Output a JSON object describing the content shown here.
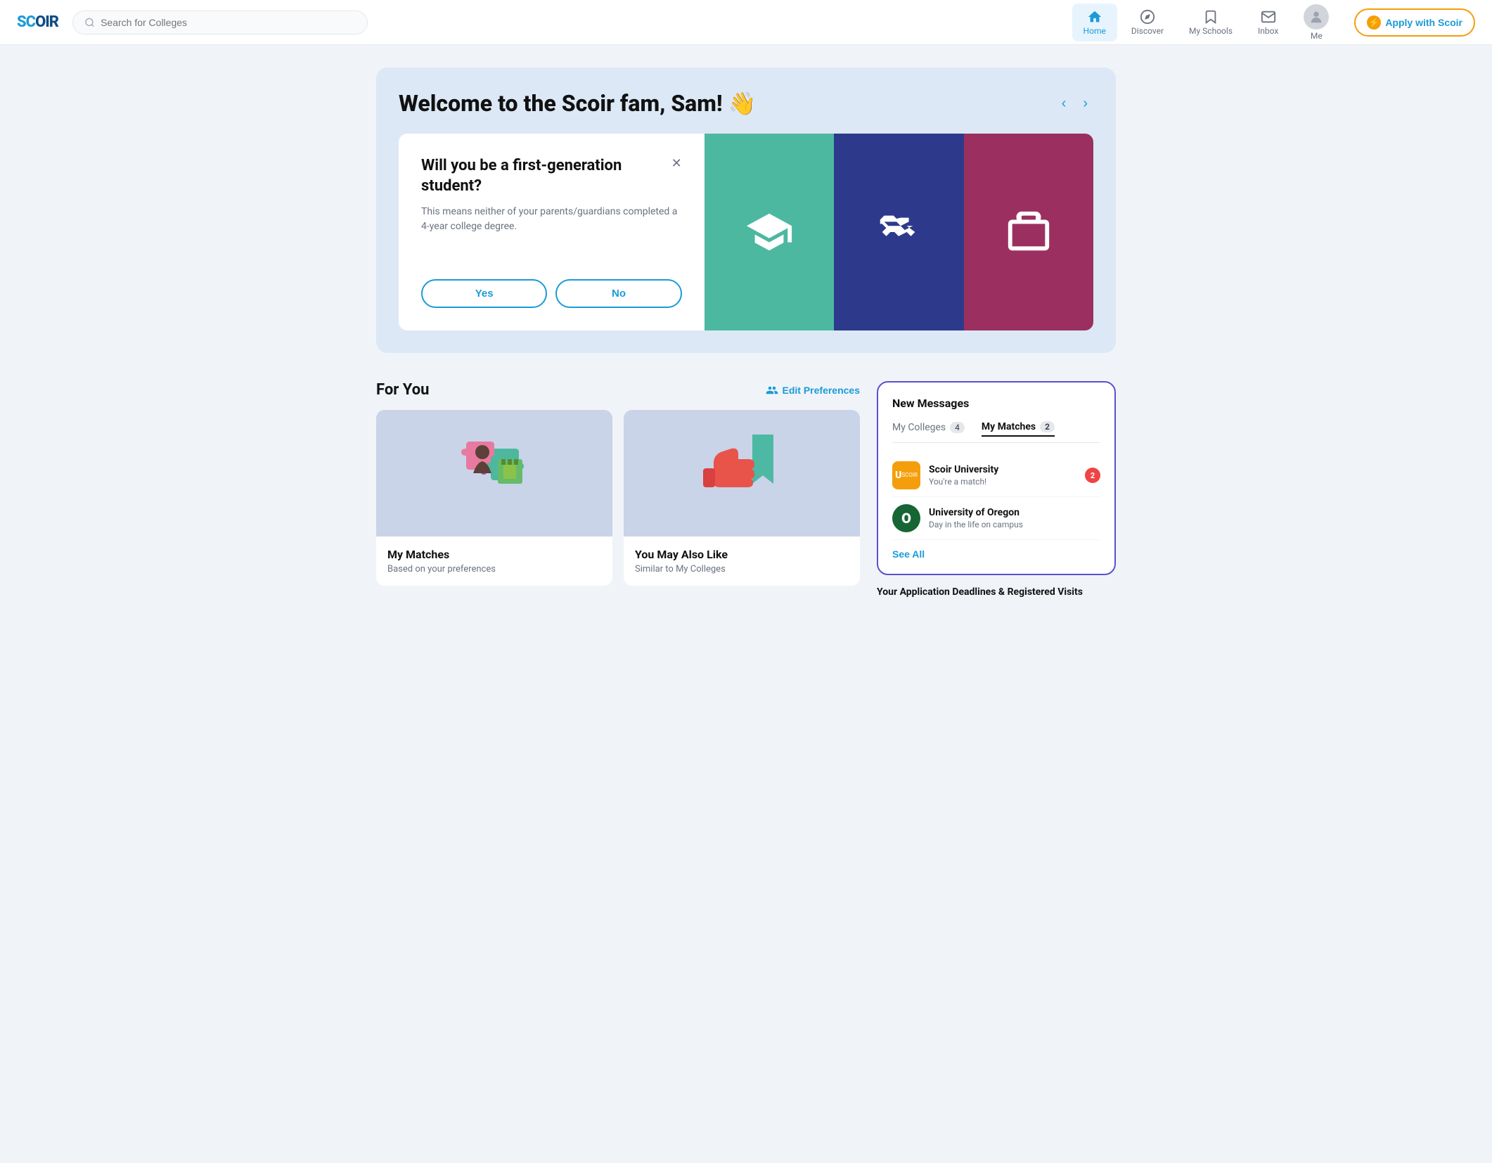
{
  "brand": {
    "logo_s": "SC",
    "logo_full": "SCOIR"
  },
  "navbar": {
    "search_placeholder": "Search for Colleges",
    "nav_items": [
      {
        "id": "home",
        "label": "Home",
        "active": true
      },
      {
        "id": "discover",
        "label": "Discover",
        "active": false
      },
      {
        "id": "my-schools",
        "label": "My Schools",
        "active": false
      },
      {
        "id": "inbox",
        "label": "Inbox",
        "active": false
      },
      {
        "id": "me",
        "label": "Me",
        "active": false
      }
    ],
    "apply_btn": "Apply with Scoir"
  },
  "welcome": {
    "title": "Welcome to the Scoir fam, Sam! 👋",
    "question_card": {
      "title": "Will you be a first-generation student?",
      "description": "This means neither of your parents/guardians completed a 4-year college degree.",
      "yes_label": "Yes",
      "no_label": "No"
    },
    "icon_cards": [
      {
        "icon": "🎓",
        "color": "teal"
      },
      {
        "icon": "🤝",
        "color": "navy"
      },
      {
        "icon": "💼",
        "color": "rose"
      }
    ]
  },
  "for_you": {
    "section_title": "For You",
    "edit_prefs_label": "Edit Preferences",
    "cards": [
      {
        "id": "my-matches",
        "title": "My Matches",
        "subtitle": "Based on your preferences",
        "image_type": "puzzle"
      },
      {
        "id": "you-may-also-like",
        "title": "You May Also Like",
        "subtitle": "Similar to My Colleges",
        "image_type": "thumbs"
      }
    ]
  },
  "messages": {
    "card_title": "New Messages",
    "tabs": [
      {
        "label": "My Colleges",
        "count": "4",
        "active": false
      },
      {
        "label": "My Matches",
        "count": "2",
        "active": true
      }
    ],
    "items": [
      {
        "school": "Scoir University",
        "preview": "You're a match!",
        "unread": "2",
        "logo_text": "U",
        "logo_color": "#f59e0b"
      },
      {
        "school": "University of Oregon",
        "preview": "Day in the life on campus",
        "unread": null,
        "logo_text": "O",
        "logo_color": "#16a34a"
      }
    ],
    "see_all": "See All"
  },
  "deadlines": {
    "title": "Your Application Deadlines & Registered Visits"
  }
}
